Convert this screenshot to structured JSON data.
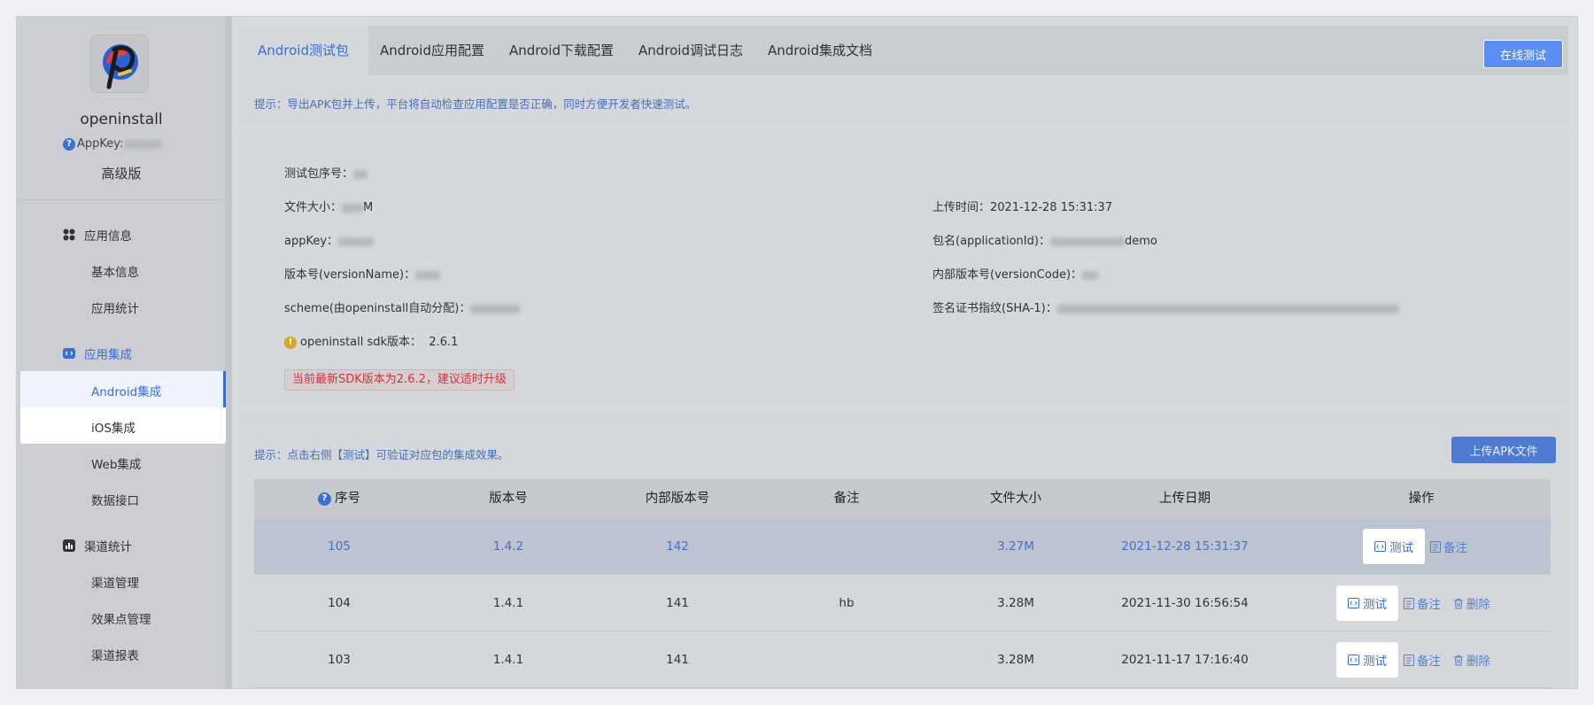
{
  "sidebar": {
    "app_name": "openinstall",
    "appkey_label": "AppKey:",
    "plan": "高级版",
    "groups": [
      {
        "label": "应用信息",
        "items": [
          "基本信息",
          "应用统计"
        ]
      },
      {
        "label": "应用集成",
        "items": [
          "Android集成",
          "iOS集成",
          "Web集成",
          "数据接口"
        ]
      },
      {
        "label": "渠道统计",
        "items": [
          "渠道管理",
          "效果点管理",
          "渠道报表"
        ]
      }
    ]
  },
  "tabs": {
    "items": [
      "Android测试包",
      "Android应用配置",
      "Android下载配置",
      "Android调试日志",
      "Android集成文档"
    ],
    "online_test_label": "在线测试",
    "hint": "提示：导出APK包并上传，平台将自动检查应用配置是否正确，同时方便开发者快速测试。"
  },
  "info": {
    "seq_label": "测试包序号：",
    "size_label": "文件大小：",
    "size_unit": "M",
    "appkey_label": "appKey：",
    "version_name_label": "版本号(versionName)：",
    "scheme_label": "scheme(由openinstall自动分配)：",
    "sdk_label": "openinstall sdk版本：",
    "sdk_version": "2.6.1",
    "upgrade_notice": "当前最新SDK版本为2.6.2，建议适时升级",
    "upload_time_label": "上传时间：",
    "upload_time": "2021-12-28 15:31:37",
    "package_label": "包名(applicationId)：",
    "package_suffix": "demo",
    "version_code_label": "内部版本号(versionCode)：",
    "sha_label": "签名证书指纹(SHA-1)："
  },
  "list": {
    "hint": "提示：点击右侧【测试】可验证对应包的集成效果。",
    "upload_label": "上传APK文件",
    "headers": [
      "序号",
      "版本号",
      "内部版本号",
      "备注",
      "文件大小",
      "上传日期",
      "操作"
    ],
    "rows": [
      {
        "seq": "105",
        "version": "1.4.2",
        "code": "142",
        "note": "",
        "size": "3.27M",
        "date": "2021-12-28 15:31:37"
      },
      {
        "seq": "104",
        "version": "1.4.1",
        "code": "141",
        "note": "hb",
        "size": "3.28M",
        "date": "2021-11-30 16:56:54"
      },
      {
        "seq": "103",
        "version": "1.4.1",
        "code": "141",
        "note": "",
        "size": "3.28M",
        "date": "2021-11-17 17:16:40"
      }
    ],
    "op_test": "测试",
    "op_note": "备注",
    "op_delete": "删除"
  }
}
